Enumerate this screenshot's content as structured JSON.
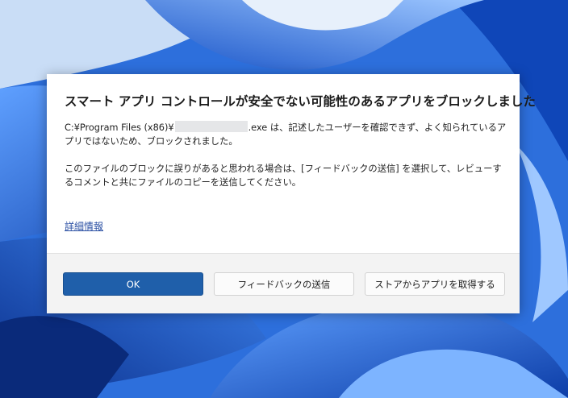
{
  "dialog": {
    "title": "スマート アプリ コントロールが安全でない可能性のあるアプリをブロックしました",
    "path_prefix": "C:¥Program Files (x86)¥",
    "path_suffix": ".exe は、記述したユーザーを確認できず、よく知られているアプリではないため、ブロックされました。",
    "paragraph2": "このファイルのブロックに誤りがあると思われる場合は、[フィードバックの送信] を選択して、レビューするコメントと共にファイルのコピーを送信してください。",
    "details_link": "詳細情報",
    "buttons": {
      "ok": "OK",
      "feedback": "フィードバックの送信",
      "store": "ストアからアプリを取得する"
    }
  },
  "colors": {
    "primary_button": "#1f5faa",
    "link": "#2a4fa3",
    "wallpaper": "#1746b0"
  }
}
